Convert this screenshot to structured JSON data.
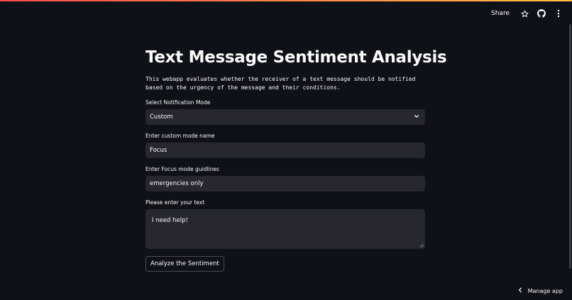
{
  "header": {
    "share_label": "Share",
    "icons": [
      "star-icon",
      "github-icon",
      "more-vertical-icon"
    ]
  },
  "main": {
    "title": "Text Message Sentiment Analysis",
    "description": "This webapp evaluates whether the receiver of a text message should be notified based on the urgency of the message and their conditions."
  },
  "form": {
    "mode_label": "Select Notification Mode",
    "mode_value": "Custom",
    "custom_name_label": "Enter custom mode name",
    "custom_name_value": "Focus",
    "guidelines_label": "Enter Focus mode guidlines",
    "guidelines_value": "emergencies only",
    "text_label": "Please enter your text",
    "text_value": "I need help!",
    "submit_label": "Analyze the Sentiment"
  },
  "footer": {
    "manage_label": "Manage app"
  },
  "colors": {
    "background": "#0e1117",
    "input_bg": "#262730",
    "text": "#fafafa",
    "accent_start": "#ff4b4b",
    "accent_end": "#ffbd45"
  }
}
